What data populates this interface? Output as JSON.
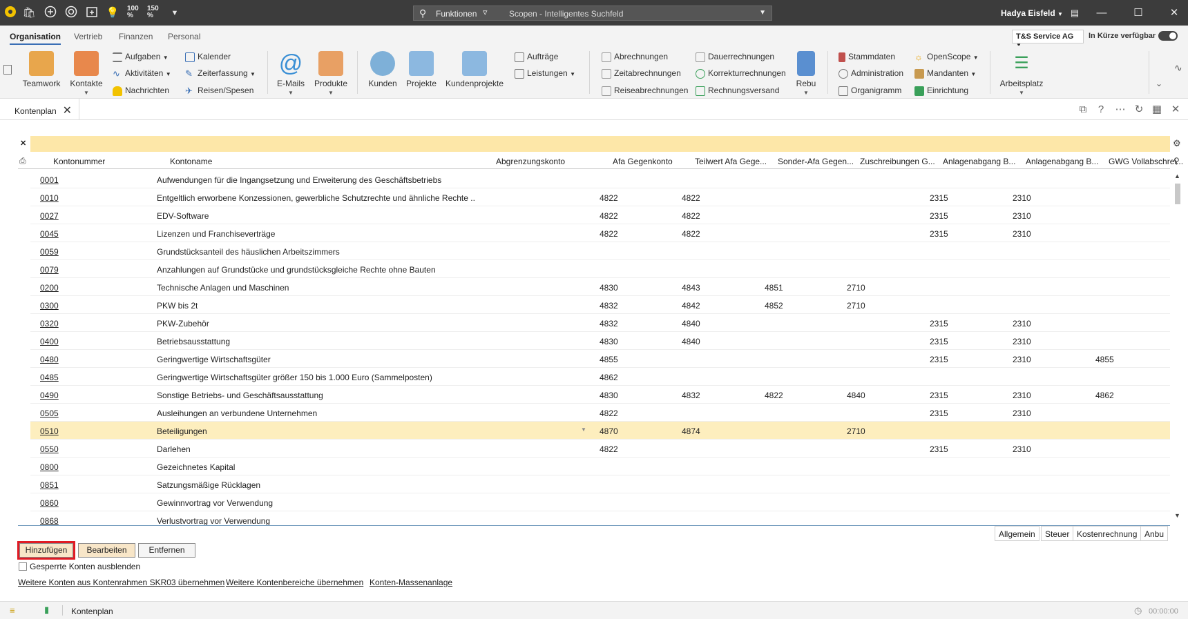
{
  "titlebar": {
    "zoom1": "100",
    "zoom2": "150",
    "pct": "%",
    "functions_label": "Funktionen",
    "search_placeholder": "Scopen - Intelligentes Suchfeld",
    "user_name": "Hadya Eisfeld"
  },
  "ribbon_tabs": [
    "Organisation",
    "Vertrieb",
    "Finanzen",
    "Personal"
  ],
  "company": "T&S Service AG",
  "soon_label": "In Kürze verfügbar",
  "ribbon": {
    "teamwork": "Teamwork",
    "kontakte": "Kontakte",
    "aufgaben": "Aufgaben",
    "aktivitaeten": "Aktivitäten",
    "nachrichten": "Nachrichten",
    "kalender": "Kalender",
    "zeiterfassung": "Zeiterfassung",
    "reisen": "Reisen/Spesen",
    "emails": "E-Mails",
    "produkte": "Produkte",
    "kunden": "Kunden",
    "projekte": "Projekte",
    "kundenprojekte": "Kundenprojekte",
    "auftraege": "Aufträge",
    "leistungen": "Leistungen",
    "abrechnungen": "Abrechnungen",
    "zeitabrechnungen": "Zeitabrechnungen",
    "reiseabrechnungen": "Reiseabrechnungen",
    "dauerrechnungen": "Dauerrechnungen",
    "korrekturrechnungen": "Korrekturrechnungen",
    "rechnungsversand": "Rechnungsversand",
    "rebu": "Rebu",
    "stammdaten": "Stammdaten",
    "administration": "Administration",
    "organigramm": "Organigramm",
    "openscope": "OpenScope",
    "mandanten": "Mandanten",
    "einrichtung": "Einrichtung",
    "arbeitsplatz": "Arbeitsplatz"
  },
  "doc_tab": "Kontenplan",
  "columns": [
    "Kontonummer",
    "Kontoname",
    "Abgrenzungskonto",
    "Afa Gegenkonto",
    "Teilwert Afa Gege...",
    "Sonder-Afa Gegen...",
    "Zuschreibungen G...",
    "Anlagenabgang B...",
    "Anlagenabgang B...",
    "GWG Vollabschrei..."
  ],
  "rows": [
    [
      "0001",
      "Aufwendungen für die Ingangsetzung und Erweiterung des Geschäftsbetriebs",
      "",
      "",
      "",
      "",
      "",
      "",
      "",
      ""
    ],
    [
      "0010",
      "Entgeltlich erworbene Konzessionen, gewerbliche Schutzrechte und ähnliche Rechte ...",
      "",
      "4822",
      "4822",
      "",
      "",
      "2315",
      "2310",
      ""
    ],
    [
      "0027",
      "EDV-Software",
      "",
      "4822",
      "4822",
      "",
      "",
      "2315",
      "2310",
      ""
    ],
    [
      "0045",
      "Lizenzen und Franchiseverträge",
      "",
      "4822",
      "4822",
      "",
      "",
      "2315",
      "2310",
      ""
    ],
    [
      "0059",
      "Grundstücksanteil des häuslichen Arbeitszimmers",
      "",
      "",
      "",
      "",
      "",
      "",
      "",
      ""
    ],
    [
      "0079",
      "Anzahlungen auf Grundstücke und grundstücksgleiche Rechte ohne Bauten",
      "",
      "",
      "",
      "",
      "",
      "",
      "",
      ""
    ],
    [
      "0200",
      "Technische Anlagen und Maschinen",
      "",
      "4830",
      "4843",
      "4851",
      "2710",
      "",
      "",
      ""
    ],
    [
      "0300",
      "PKW bis 2t",
      "",
      "4832",
      "4842",
      "4852",
      "2710",
      "",
      "",
      ""
    ],
    [
      "0320",
      "PKW-Zubehör",
      "",
      "4832",
      "4840",
      "",
      "",
      "2315",
      "2310",
      ""
    ],
    [
      "0400",
      "Betriebsausstattung",
      "",
      "4830",
      "4840",
      "",
      "",
      "2315",
      "2310",
      ""
    ],
    [
      "0480",
      "Geringwertige Wirtschaftsgüter",
      "",
      "4855",
      "",
      "",
      "",
      "2315",
      "2310",
      "4855"
    ],
    [
      "0485",
      "Geringwertige Wirtschaftsgüter größer 150 bis 1.000 Euro (Sammelposten)",
      "",
      "4862",
      "",
      "",
      "",
      "",
      "",
      ""
    ],
    [
      "0490",
      "Sonstige Betriebs- und Geschäftsausstattung",
      "",
      "4830",
      "4832",
      "4822",
      "4840",
      "2315",
      "2310",
      "4862"
    ],
    [
      "0505",
      "Ausleihungen an verbundene Unternehmen",
      "",
      "4822",
      "",
      "",
      "",
      "2315",
      "2310",
      ""
    ],
    [
      "0510",
      "Beteiligungen",
      "",
      "4870",
      "4874",
      "",
      "2710",
      "",
      "",
      ""
    ],
    [
      "0550",
      "Darlehen",
      "",
      "4822",
      "",
      "",
      "",
      "2315",
      "2310",
      ""
    ],
    [
      "0800",
      "Gezeichnetes Kapital",
      "",
      "",
      "",
      "",
      "",
      "",
      "",
      ""
    ],
    [
      "0851",
      "Satzungsmäßige Rücklagen",
      "",
      "",
      "",
      "",
      "",
      "",
      "",
      ""
    ],
    [
      "0860",
      "Gewinnvortrag vor Verwendung",
      "",
      "",
      "",
      "",
      "",
      "",
      "",
      ""
    ],
    [
      "0868",
      "Verlustvortrag vor Verwendung",
      "",
      "",
      "",
      "",
      "",
      "",
      "",
      ""
    ]
  ],
  "bottom_tabs": [
    "Allgemein",
    "Steuer",
    "Kostenrechnung",
    "Anbu"
  ],
  "buttons": {
    "add": "Hinzufügen",
    "edit": "Bearbeiten",
    "remove": "Entfernen"
  },
  "checkbox_label": "Gesperrte Konten ausblenden",
  "links": [
    "Weitere Konten aus Kontenrahmen SKR03 übernehmen",
    "Weitere Kontenbereiche übernehmen",
    "Konten-Massenanlage"
  ],
  "status": {
    "label": "Kontenplan",
    "timer": "00:00:00"
  }
}
